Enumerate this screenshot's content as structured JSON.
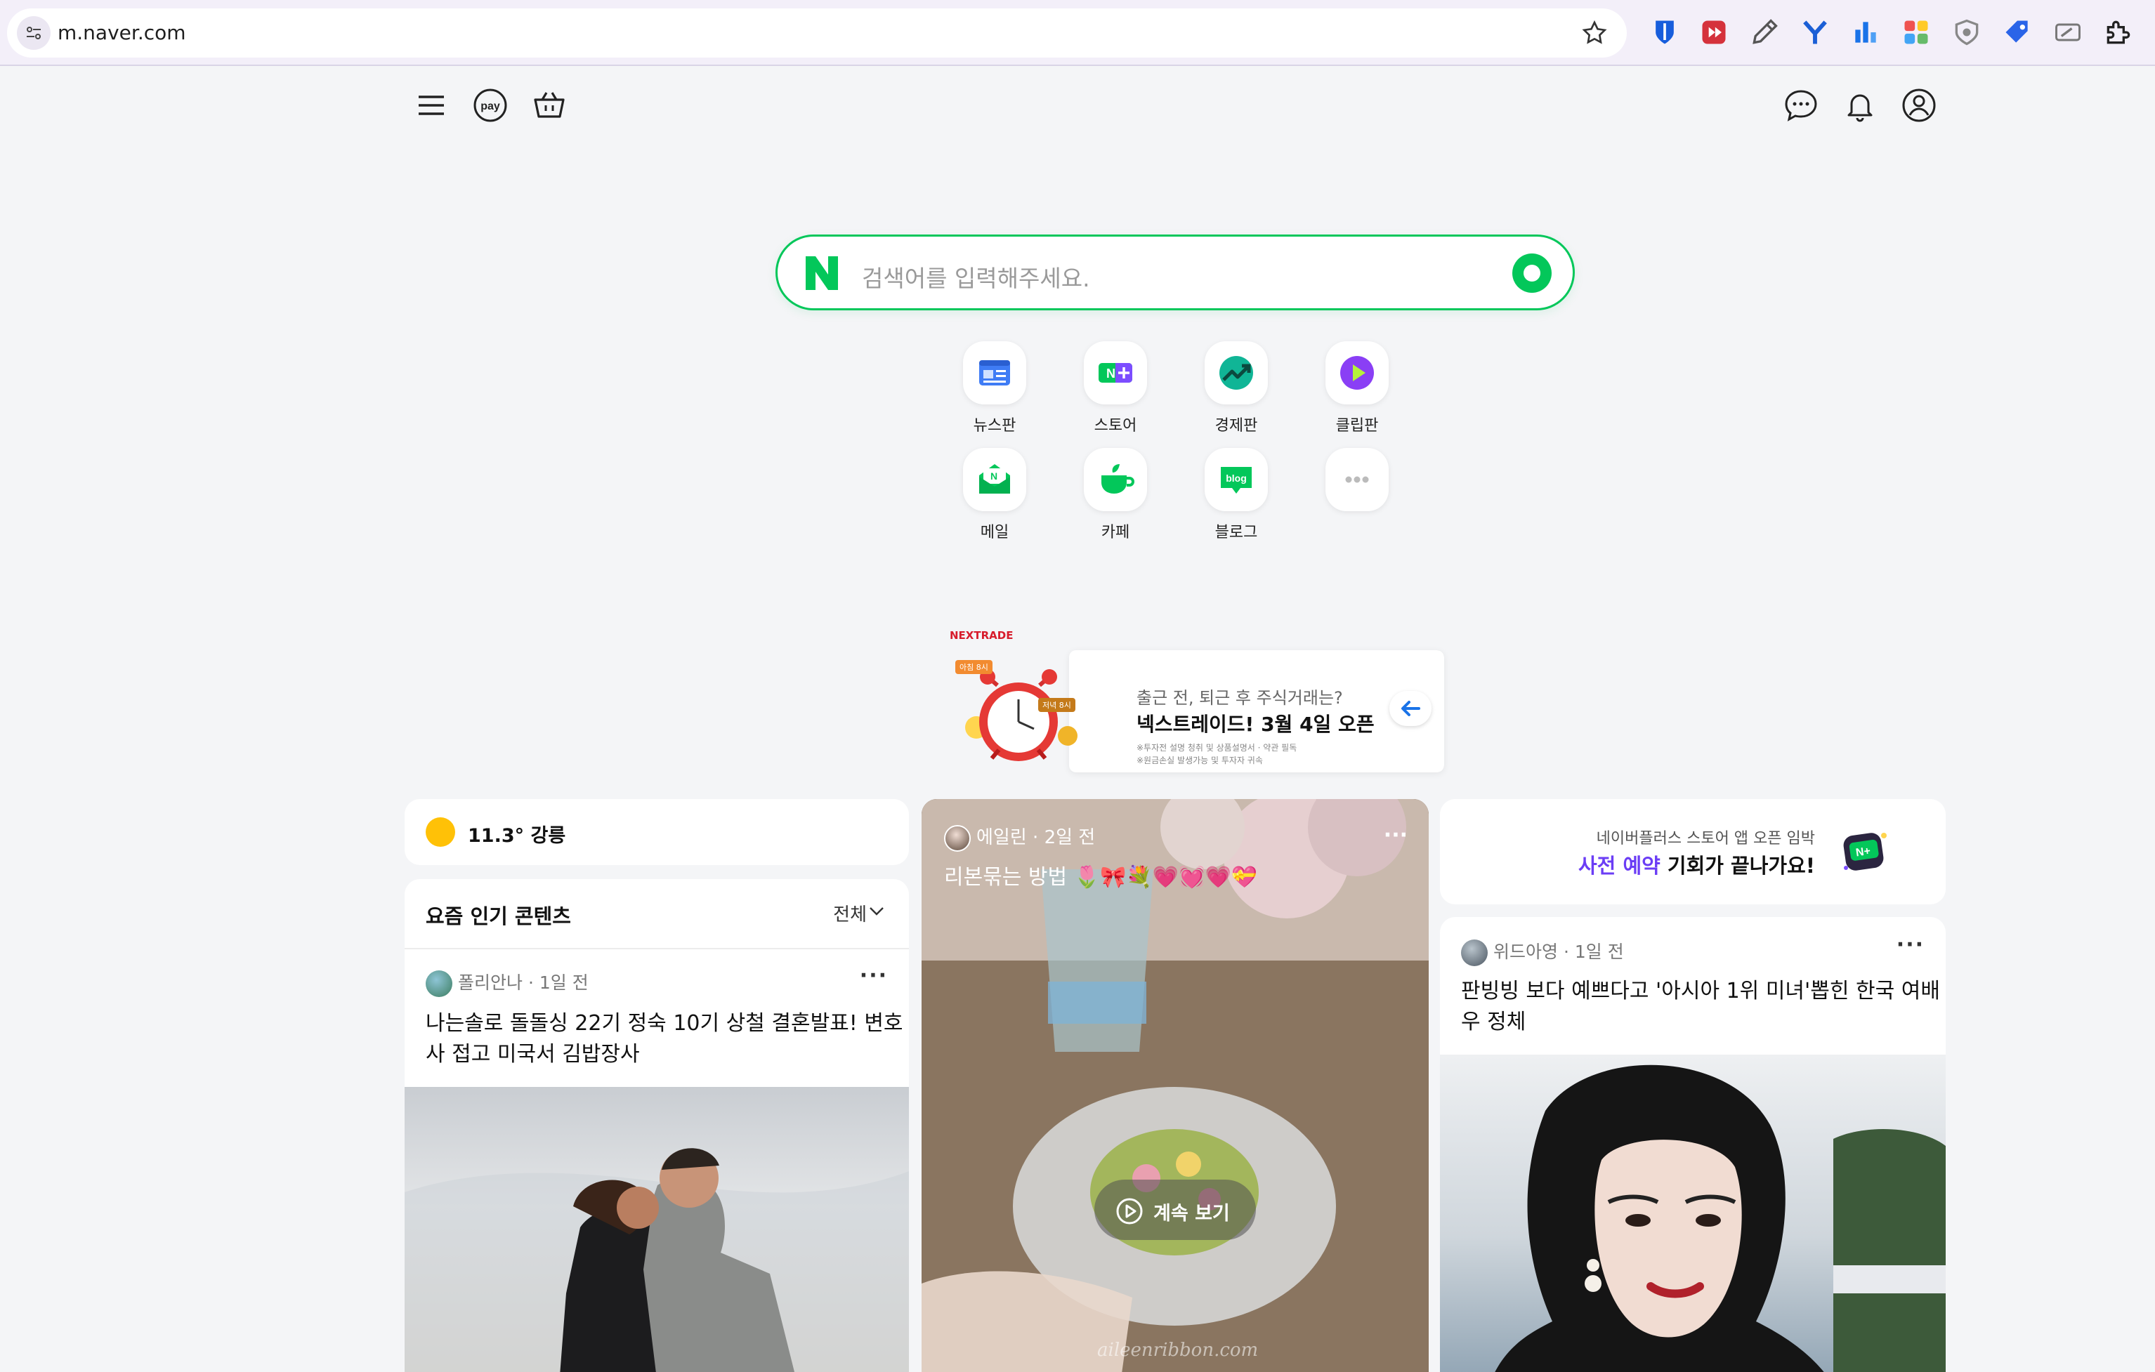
{
  "browser": {
    "url": "m.naver.com"
  },
  "search": {
    "placeholder": "검색어를 입력해주세요."
  },
  "shortcuts": [
    {
      "label": "뉴스판",
      "icon": "newspaper-icon"
    },
    {
      "label": "스토어",
      "icon": "store-icon"
    },
    {
      "label": "경제판",
      "icon": "chart-icon"
    },
    {
      "label": "클립판",
      "icon": "play-icon"
    },
    {
      "label": "메일",
      "icon": "mail-icon"
    },
    {
      "label": "카페",
      "icon": "cafe-icon"
    },
    {
      "label": "블로그",
      "icon": "blog-icon"
    },
    {
      "label": "",
      "icon": "more-icon"
    }
  ],
  "banner": {
    "brand": "NEXTRADE",
    "tag_morning": "아침 8시",
    "tag_evening": "저녁 8시",
    "subtitle": "출근 전, 퇴근 후 주식거래는?",
    "title": "넥스트레이드! 3월 4일 오픈",
    "note1": "※투자전 설명 청취 및 상품설명서 · 약관 필독",
    "note2": "※원금손실 발생가능 및 투자자 귀속"
  },
  "weather": {
    "text": "11.3° 강릉"
  },
  "popular": {
    "title": "요즘 인기 콘텐츠",
    "filter": "전체",
    "post": {
      "author": "폴리안나",
      "time": "1일 전",
      "title_line1": "나는솔로 돌돌싱 22기 정숙 10기 상철 결혼발표! 변호",
      "title_line2": "사 접고 미국서 김밥장사"
    }
  },
  "video": {
    "author": "에일린",
    "time": "2일 전",
    "title": "리본묶는 방법 🌷🎀💐💗💓💗💝",
    "continue_label": "계속 보기",
    "watermark": "aileenribbon.com"
  },
  "ad": {
    "line1": "네이버플러스 스토어 앱 오픈 임박",
    "line2_em": "사전 예약",
    "line2_rest": " 기회가 끝나가요!"
  },
  "post3": {
    "author": "위드아영",
    "time": "1일 전",
    "title_line1": "판빙빙 보다 예쁘다고 '아시아 1위 미녀'뽑힌 한국 여배",
    "title_line2": "우 정체"
  },
  "colors": {
    "naver_green": "#03c75a",
    "accent_purple": "#6b3df5"
  }
}
